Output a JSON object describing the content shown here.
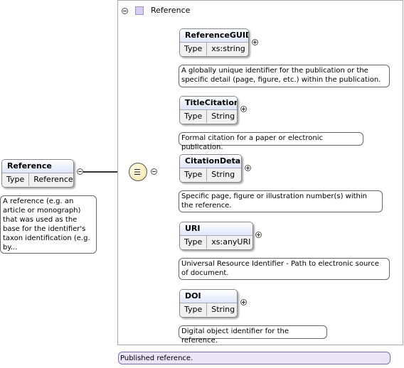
{
  "root": {
    "name": "Reference",
    "type_label": "Type",
    "type_value": "Reference",
    "doc": "A reference (e.g. an article or monograph) that was used as the base for the identifier's taxon identification (e.g. by..."
  },
  "frame": {
    "title": "Reference",
    "note": "Published reference."
  },
  "children": [
    {
      "name": "ReferenceGUID",
      "type_label": "Type",
      "type_value": "xs:string",
      "doc": "A globally unique identifier for the publication or the specific detail (page, figure, etc.) within the publication."
    },
    {
      "name": "TitleCitation",
      "type_label": "Type",
      "type_value": "String",
      "doc": "Formal citation for a paper or electronic publication."
    },
    {
      "name": "CitationDetail",
      "type_label": "Type",
      "type_value": "String",
      "doc": "Specific page, figure or illustration number(s) within the reference."
    },
    {
      "name": "URI",
      "type_label": "Type",
      "type_value": "xs:anyURI",
      "doc": "Universal Resource Identifier - Path to electronic source of document."
    },
    {
      "name": "DOI",
      "type_label": "Type",
      "type_value": "String",
      "doc": "Digital object identifier for the reference."
    }
  ],
  "icons": {
    "collapse": "collapse-icon",
    "expand": "expand-icon",
    "sequence": "sequence-compositor-icon",
    "complex_type": "complex-type-icon"
  },
  "colors": {
    "header_gradient": "#dde5f9",
    "type_icon": "#d6cdf2",
    "note_bg": "#e9e5f7",
    "compositor": "#f4e4a4"
  }
}
